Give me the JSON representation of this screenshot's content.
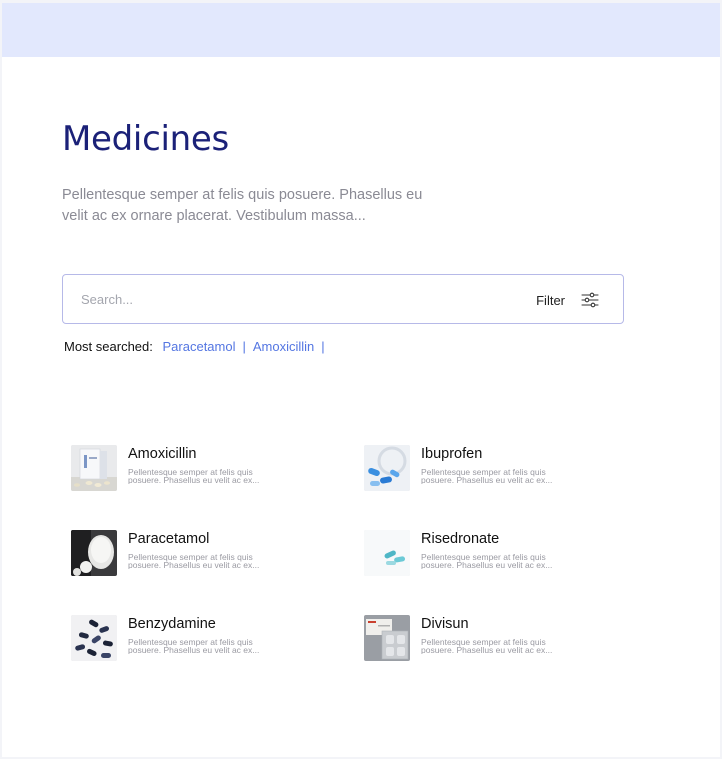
{
  "header": {
    "title": "Medicines"
  },
  "intro": {
    "description": "Pellentesque semper at felis quis posuere. Phasellus eu velit ac ex ornare placerat. Vestibulum massa..."
  },
  "search": {
    "placeholder": "Search...",
    "value": "",
    "filter_label": "Filter",
    "filter_icon": "sliders-icon"
  },
  "most_searched": {
    "label": "Most searched:",
    "links": [
      "Paracetamol",
      "Amoxicillin"
    ],
    "separator": "|"
  },
  "medicines": [
    {
      "name": "Amoxicillin",
      "description": "Pellentesque semper at felis quis posuere. Phasellus eu velit ac ex...",
      "image": "medicine-box-photo"
    },
    {
      "name": "Ibuprofen",
      "description": "Pellentesque semper at felis quis posuere. Phasellus eu velit ac ex...",
      "image": "blue-capsules-photo"
    },
    {
      "name": "Paracetamol",
      "description": "Pellentesque semper at felis quis posuere. Phasellus eu velit ac ex...",
      "image": "white-pill-bottle-photo"
    },
    {
      "name": "Risedronate",
      "description": "Pellentesque semper at felis quis posuere. Phasellus eu velit ac ex...",
      "image": "teal-capsules-photo"
    },
    {
      "name": "Benzydamine",
      "description": "Pellentesque semper at felis quis posuere. Phasellus eu velit ac ex...",
      "image": "dark-capsules-photo"
    },
    {
      "name": "Divisun",
      "description": "Pellentesque semper at felis quis posuere. Phasellus eu velit ac ex...",
      "image": "blister-pack-photo"
    }
  ],
  "colors": {
    "top_bar": "#e2e8fd",
    "title": "#1b2178",
    "link": "#5476e2",
    "search_border": "#b6b9e8"
  }
}
